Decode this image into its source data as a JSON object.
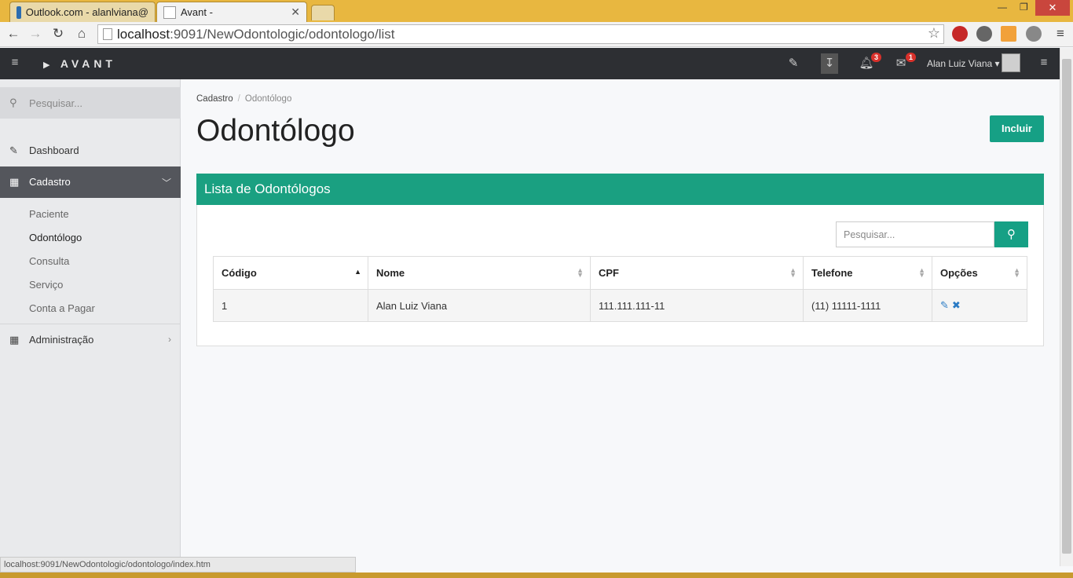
{
  "browser": {
    "tabs": [
      {
        "label": "Outlook.com - alanlviana@"
      },
      {
        "label": "Avant -"
      }
    ],
    "url_host": "localhost",
    "url_path": ":9091/NewOdontologic/odontologo/list",
    "status_url": "localhost:9091/NewOdontologic/odontologo/index.htm"
  },
  "topnav": {
    "brand": "AVANT",
    "notifications_count": "3",
    "messages_count": "1",
    "user_name": "Alan Luiz Viana"
  },
  "sidebar": {
    "search_placeholder": "Pesquisar...",
    "items": [
      {
        "label": "Dashboard"
      },
      {
        "label": "Cadastro"
      },
      {
        "label": "Administração"
      }
    ],
    "subitems": [
      {
        "label": "Paciente"
      },
      {
        "label": "Odontólogo"
      },
      {
        "label": "Consulta"
      },
      {
        "label": "Serviço"
      },
      {
        "label": "Conta a Pagar"
      }
    ]
  },
  "content": {
    "breadcrumb": {
      "parent": "Cadastro",
      "current": "Odontólogo"
    },
    "title": "Odontólogo",
    "add_button": "Incluir",
    "panel_title": "Lista de Odontólogos",
    "table_search_placeholder": "Pesquisar...",
    "columns": [
      "Código",
      "Nome",
      "CPF",
      "Telefone",
      "Opções"
    ],
    "rows": [
      {
        "codigo": "1",
        "nome": "Alan Luiz Viana",
        "cpf": "111.111.111-11",
        "telefone": "(11) 11111-1111"
      }
    ]
  }
}
